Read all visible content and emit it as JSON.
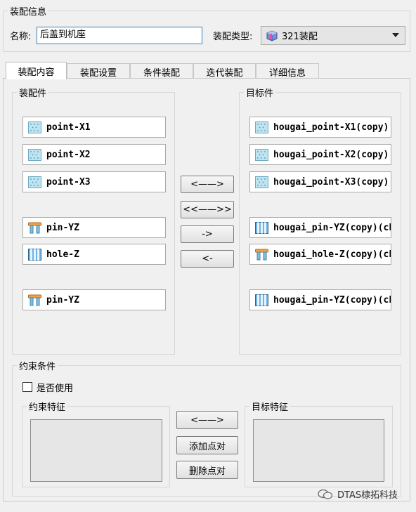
{
  "assembly_info": {
    "group_title": "装配信息",
    "name_label": "名称:",
    "name_value": "后盖到机座",
    "type_label": "装配类型:",
    "type_value": "321装配"
  },
  "tabs": [
    "装配内容",
    "装配设置",
    "条件装配",
    "迭代装配",
    "详细信息"
  ],
  "assembly_parts": {
    "title": "装配件",
    "items": [
      {
        "label": "point-X1",
        "icon": "point-icon"
      },
      {
        "label": "point-X2",
        "icon": "point-icon"
      },
      {
        "label": "point-X3",
        "icon": "point-icon"
      },
      {
        "label": "pin-YZ",
        "icon": "pin-icon"
      },
      {
        "label": "hole-Z",
        "icon": "hole-icon"
      },
      {
        "label": "pin-YZ",
        "icon": "pin-icon"
      }
    ]
  },
  "target_parts": {
    "title": "目标件",
    "items": [
      {
        "label": "hougai_point-X1(copy)",
        "icon": "point-icon"
      },
      {
        "label": "hougai_point-X2(copy)",
        "icon": "point-icon"
      },
      {
        "label": "hougai_point-X3(copy)",
        "icon": "point-icon"
      },
      {
        "label": "hougai_pin-YZ(copy)(ch",
        "icon": "hole-icon"
      },
      {
        "label": "hougai_hole-Z(copy)(ch",
        "icon": "pin-icon"
      },
      {
        "label": "hougai_pin-YZ(copy)(ch",
        "icon": "hole-icon"
      }
    ]
  },
  "mapping_buttons": {
    "swap": "<——>",
    "swap_all": "<<——>>",
    "right": "->",
    "left": "<-"
  },
  "constraints": {
    "title": "约束条件",
    "use_label": "是否使用",
    "use_checked": false,
    "constraint_features_title": "约束特征",
    "target_features_title": "目标特征",
    "swap_button": "<——>",
    "add_pair_button": "添加点对",
    "delete_pair_button": "删除点对"
  },
  "watermark": "DTAS棣拓科技"
}
